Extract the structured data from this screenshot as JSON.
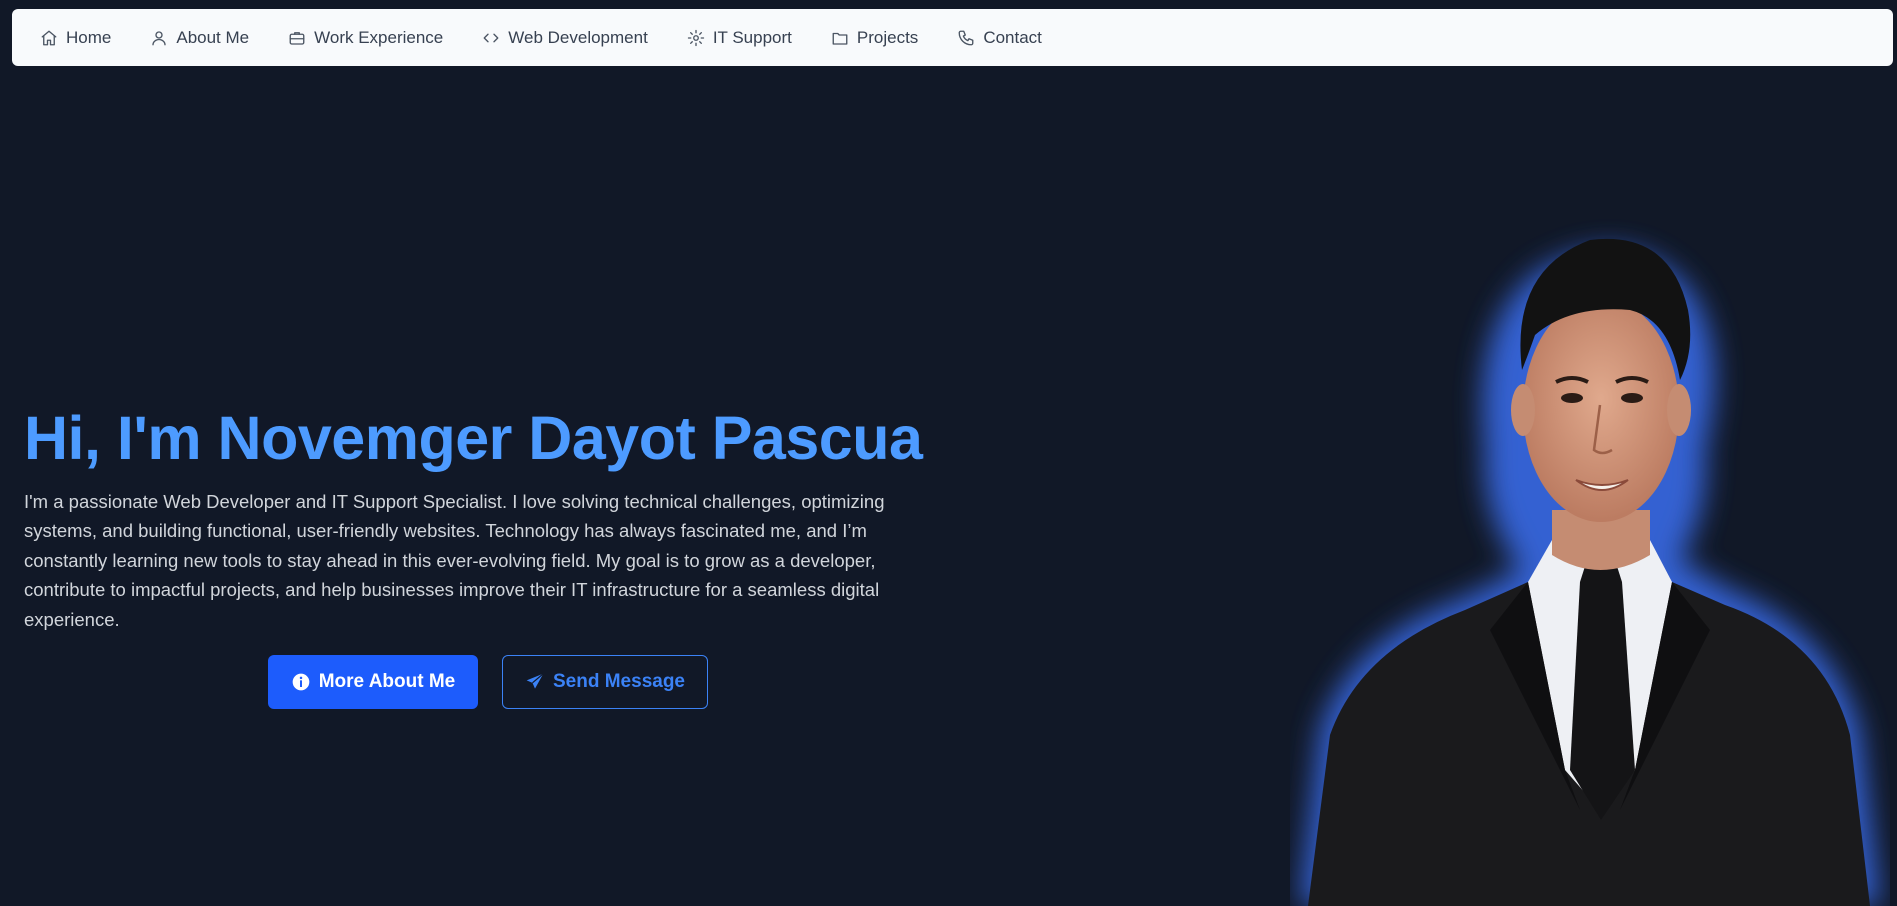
{
  "nav": {
    "items": [
      {
        "label": "Home",
        "icon": "home-icon"
      },
      {
        "label": "About Me",
        "icon": "user-icon"
      },
      {
        "label": "Work Experience",
        "icon": "briefcase-icon"
      },
      {
        "label": "Web Development",
        "icon": "code-icon"
      },
      {
        "label": "IT Support",
        "icon": "gear-icon"
      },
      {
        "label": "Projects",
        "icon": "folder-icon"
      },
      {
        "label": "Contact",
        "icon": "phone-icon"
      }
    ]
  },
  "hero": {
    "title": "Hi, I'm Novemger Dayot Pascua",
    "text": "I'm a passionate Web Developer and IT Support Specialist. I love solving technical challenges, optimizing systems, and building functional, user-friendly websites. Technology has always fascinated me, and I’m constantly learning new tools to stay ahead in this ever-evolving field. My goal is to grow as a developer, contribute to impactful projects, and help businesses improve their IT infrastructure for a seamless digital experience.",
    "primary_button": "More About Me",
    "secondary_button": "Send Message"
  },
  "colors": {
    "background": "#111827",
    "accent": "#4d9bff",
    "primary_button": "#1d5cfc",
    "nav_bg": "#f8fafc"
  }
}
